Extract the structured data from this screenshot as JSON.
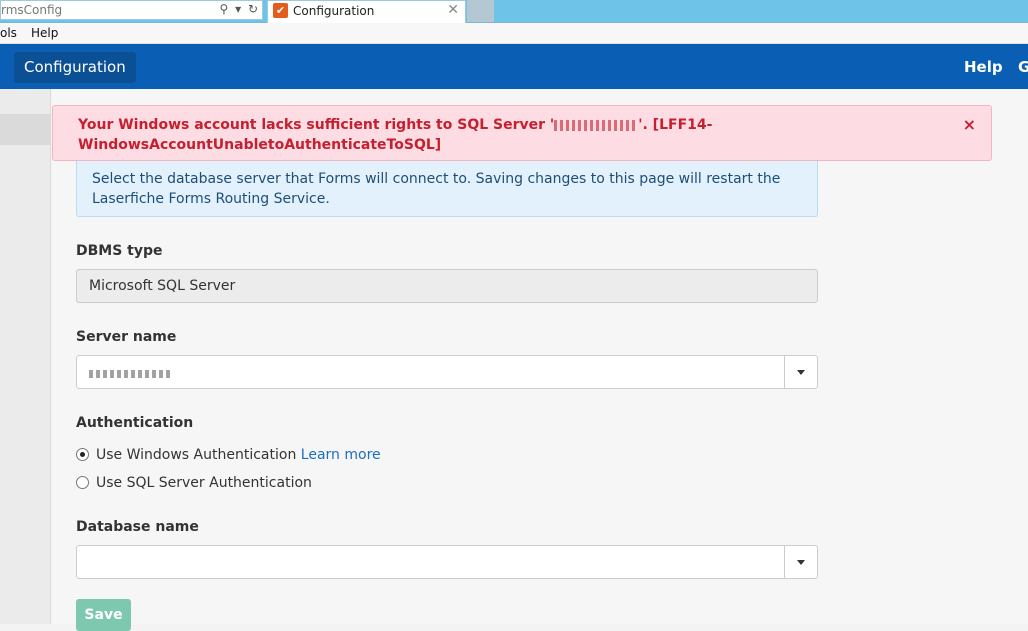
{
  "browser": {
    "address_text": "rmsConfig",
    "tab_title": "Configuration",
    "tab_favicon_glyph": "✔",
    "close_glyph": "✕"
  },
  "menu": {
    "items": [
      "ols",
      "Help"
    ]
  },
  "header": {
    "brand": "Configuration",
    "help": "Help",
    "partial": "G"
  },
  "alert": {
    "message_part1": "Your Windows account lacks sufficient rights to SQL Server '",
    "message_part2": "'. [LFF14-WindowsAccountUnabletoAuthenticateToSQL]",
    "close_glyph": "×"
  },
  "info": {
    "text": "Select the database server that Forms will connect to. Saving changes to this page will restart the Laserfiche Forms Routing Service."
  },
  "form": {
    "dbms_label": "DBMS type",
    "dbms_value": "Microsoft SQL Server",
    "server_label": "Server name",
    "auth_label": "Authentication",
    "auth_windows": "Use Windows Authentication",
    "learn_more": "Learn more",
    "auth_sql": "Use SQL Server Authentication",
    "db_label": "Database name",
    "db_value": "",
    "save": "Save"
  },
  "colors": {
    "header_blue": "#0a5fb4",
    "error_text": "#c4202f",
    "info_text": "#1d4e78",
    "save_green": "#7fc8b0"
  }
}
